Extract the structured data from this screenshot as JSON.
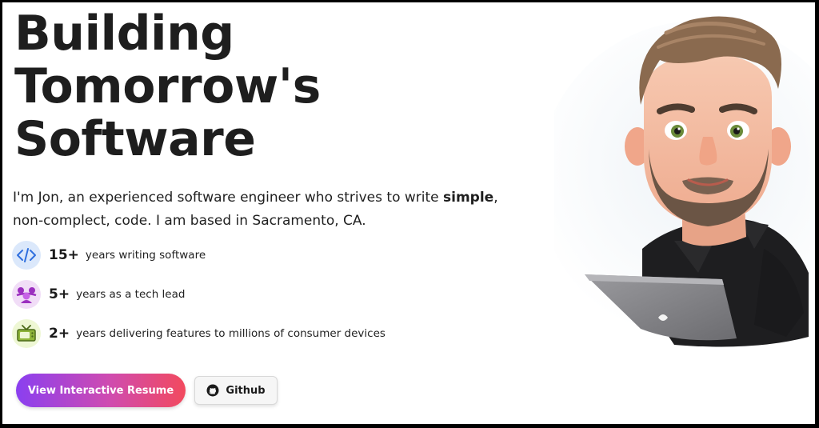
{
  "hero": {
    "title_lines": [
      "Building",
      "Tomorrow's",
      "Software"
    ],
    "intro_before": "I'm Jon, an experienced software engineer who strives to write ",
    "intro_bold": "simple",
    "intro_after": ", non-complect, code. I am based in Sacramento, CA."
  },
  "stats": [
    {
      "number": "15+",
      "label": "years writing software",
      "icon": "code-icon"
    },
    {
      "number": "5+",
      "label": "years as a tech lead",
      "icon": "team-icon"
    },
    {
      "number": "2+",
      "label": "years delivering features to millions of consumer devices",
      "icon": "tv-icon"
    }
  ],
  "buttons": {
    "primary_label": "View Interactive Resume",
    "secondary_label": "Github"
  },
  "colors": {
    "text_dark": "#1e1e1e",
    "gradient_start": "#8a3ff0",
    "gradient_end": "#f24a5e",
    "code_icon_bg": "#dbe8fb",
    "team_icon_bg": "#f1ddf7",
    "tv_icon_bg": "#eef7d4"
  }
}
